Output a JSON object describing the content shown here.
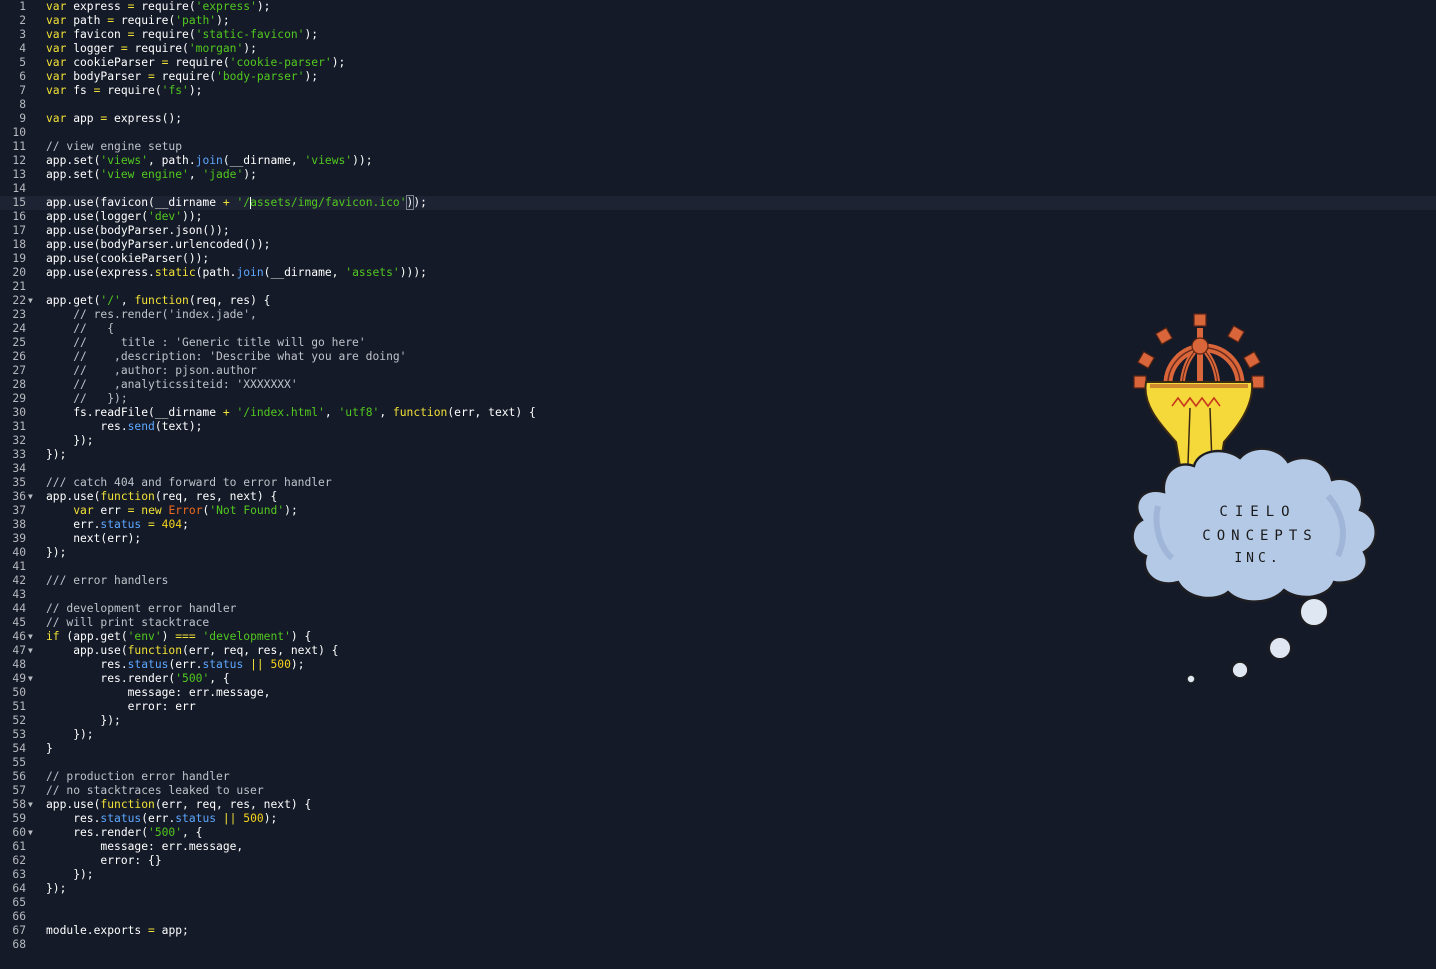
{
  "editor": {
    "lines": [
      {
        "t": [
          {
            "s": "var",
            "c": "k"
          },
          {
            "s": " express "
          },
          {
            "s": "=",
            "c": "k"
          },
          {
            "s": " require("
          },
          {
            "s": "'express'",
            "c": "s"
          },
          {
            "s": ");"
          }
        ]
      },
      {
        "t": [
          {
            "s": "var",
            "c": "k"
          },
          {
            "s": " path "
          },
          {
            "s": "=",
            "c": "k"
          },
          {
            "s": " require("
          },
          {
            "s": "'path'",
            "c": "s"
          },
          {
            "s": ");"
          }
        ]
      },
      {
        "t": [
          {
            "s": "var",
            "c": "k"
          },
          {
            "s": " favicon "
          },
          {
            "s": "=",
            "c": "k"
          },
          {
            "s": " require("
          },
          {
            "s": "'static-favicon'",
            "c": "s"
          },
          {
            "s": ");"
          }
        ]
      },
      {
        "t": [
          {
            "s": "var",
            "c": "k"
          },
          {
            "s": " logger "
          },
          {
            "s": "=",
            "c": "k"
          },
          {
            "s": " require("
          },
          {
            "s": "'morgan'",
            "c": "s"
          },
          {
            "s": ");"
          }
        ]
      },
      {
        "t": [
          {
            "s": "var",
            "c": "k"
          },
          {
            "s": " cookieParser "
          },
          {
            "s": "=",
            "c": "k"
          },
          {
            "s": " require("
          },
          {
            "s": "'cookie-parser'",
            "c": "s"
          },
          {
            "s": ");"
          }
        ]
      },
      {
        "t": [
          {
            "s": "var",
            "c": "k"
          },
          {
            "s": " bodyParser "
          },
          {
            "s": "=",
            "c": "k"
          },
          {
            "s": " require("
          },
          {
            "s": "'body-parser'",
            "c": "s"
          },
          {
            "s": ");"
          }
        ]
      },
      {
        "t": [
          {
            "s": "var",
            "c": "k"
          },
          {
            "s": " fs "
          },
          {
            "s": "=",
            "c": "k"
          },
          {
            "s": " require("
          },
          {
            "s": "'fs'",
            "c": "s"
          },
          {
            "s": ");"
          }
        ]
      },
      {
        "t": []
      },
      {
        "t": [
          {
            "s": "var",
            "c": "k"
          },
          {
            "s": " app "
          },
          {
            "s": "=",
            "c": "k"
          },
          {
            "s": " express();"
          }
        ]
      },
      {
        "t": []
      },
      {
        "t": [
          {
            "s": "// view engine setup",
            "c": "c"
          }
        ]
      },
      {
        "t": [
          {
            "s": "app.set("
          },
          {
            "s": "'views'",
            "c": "s"
          },
          {
            "s": ", path."
          },
          {
            "s": "join",
            "c": "b"
          },
          {
            "s": "(__dirname, "
          },
          {
            "s": "'views'",
            "c": "s"
          },
          {
            "s": "));"
          }
        ]
      },
      {
        "t": [
          {
            "s": "app.set("
          },
          {
            "s": "'view engine'",
            "c": "s"
          },
          {
            "s": ", "
          },
          {
            "s": "'jade'",
            "c": "s"
          },
          {
            "s": ");"
          }
        ]
      },
      {
        "t": []
      },
      {
        "cur": true,
        "t": [
          {
            "s": "app.use(favicon(__dirname "
          },
          {
            "s": "+",
            "c": "k"
          },
          {
            "s": " "
          },
          {
            "s": "'/",
            "c": "s"
          },
          {
            "caret": true
          },
          {
            "s": "assets/img/favicon.ico'",
            "c": "s"
          },
          {
            "s": ")",
            "br": true
          },
          {
            "s": ");"
          }
        ]
      },
      {
        "t": [
          {
            "s": "app.use(logger("
          },
          {
            "s": "'dev'",
            "c": "s"
          },
          {
            "s": "));"
          }
        ]
      },
      {
        "t": [
          {
            "s": "app.use(bodyParser.json());"
          }
        ]
      },
      {
        "t": [
          {
            "s": "app.use(bodyParser.urlencoded());"
          }
        ]
      },
      {
        "t": [
          {
            "s": "app.use(cookieParser());"
          }
        ]
      },
      {
        "t": [
          {
            "s": "app.use(express."
          },
          {
            "s": "static",
            "c": "k"
          },
          {
            "s": "(path."
          },
          {
            "s": "join",
            "c": "b"
          },
          {
            "s": "(__dirname, "
          },
          {
            "s": "'assets'",
            "c": "s"
          },
          {
            "s": ")));"
          }
        ]
      },
      {
        "t": []
      },
      {
        "fold": true,
        "t": [
          {
            "s": "app.get("
          },
          {
            "s": "'/'",
            "c": "s"
          },
          {
            "s": ", "
          },
          {
            "s": "function",
            "c": "k"
          },
          {
            "s": "(req, res) {"
          }
        ]
      },
      {
        "t": [
          {
            "s": "    // res.render('index.jade',",
            "c": "c"
          }
        ]
      },
      {
        "t": [
          {
            "s": "    //   {",
            "c": "c"
          }
        ]
      },
      {
        "t": [
          {
            "s": "    //     title : 'Generic title will go here'",
            "c": "c"
          }
        ]
      },
      {
        "t": [
          {
            "s": "    //    ,description: 'Describe what you are doing'",
            "c": "c"
          }
        ]
      },
      {
        "t": [
          {
            "s": "    //    ,author: pjson.author",
            "c": "c"
          }
        ]
      },
      {
        "t": [
          {
            "s": "    //    ,analyticssiteid: 'XXXXXXX'",
            "c": "c"
          }
        ]
      },
      {
        "t": [
          {
            "s": "    //   });",
            "c": "c"
          }
        ]
      },
      {
        "t": [
          {
            "s": "    fs.readFile(__dirname "
          },
          {
            "s": "+",
            "c": "k"
          },
          {
            "s": " "
          },
          {
            "s": "'/index.html'",
            "c": "s"
          },
          {
            "s": ", "
          },
          {
            "s": "'utf8'",
            "c": "s"
          },
          {
            "s": ", "
          },
          {
            "s": "function",
            "c": "k"
          },
          {
            "s": "(err, text) {"
          }
        ]
      },
      {
        "t": [
          {
            "s": "        res."
          },
          {
            "s": "send",
            "c": "b"
          },
          {
            "s": "(text);"
          }
        ]
      },
      {
        "t": [
          {
            "s": "    });"
          }
        ]
      },
      {
        "t": [
          {
            "s": "});"
          }
        ]
      },
      {
        "t": []
      },
      {
        "t": [
          {
            "s": "/// catch 404 and forward to error handler",
            "c": "c"
          }
        ]
      },
      {
        "fold": true,
        "t": [
          {
            "s": "app.use("
          },
          {
            "s": "function",
            "c": "k"
          },
          {
            "s": "(req, res, next) {"
          }
        ]
      },
      {
        "t": [
          {
            "s": "    "
          },
          {
            "s": "var",
            "c": "k"
          },
          {
            "s": " err "
          },
          {
            "s": "=",
            "c": "k"
          },
          {
            "s": " "
          },
          {
            "s": "new",
            "c": "k"
          },
          {
            "s": " "
          },
          {
            "s": "Error",
            "c": "cl"
          },
          {
            "s": "("
          },
          {
            "s": "'Not Found'",
            "c": "s"
          },
          {
            "s": ");"
          }
        ]
      },
      {
        "t": [
          {
            "s": "    err."
          },
          {
            "s": "status",
            "c": "b"
          },
          {
            "s": " "
          },
          {
            "s": "=",
            "c": "k"
          },
          {
            "s": " "
          },
          {
            "s": "404",
            "c": "n"
          },
          {
            "s": ";"
          }
        ]
      },
      {
        "t": [
          {
            "s": "    next(err);"
          }
        ]
      },
      {
        "t": [
          {
            "s": "});"
          }
        ]
      },
      {
        "t": []
      },
      {
        "t": [
          {
            "s": "/// error handlers",
            "c": "c"
          }
        ]
      },
      {
        "t": []
      },
      {
        "t": [
          {
            "s": "// development error handler",
            "c": "c"
          }
        ]
      },
      {
        "t": [
          {
            "s": "// will print stacktrace",
            "c": "c"
          }
        ]
      },
      {
        "fold": true,
        "t": [
          {
            "s": "if",
            "c": "k"
          },
          {
            "s": " (app.get("
          },
          {
            "s": "'env'",
            "c": "s"
          },
          {
            "s": ") "
          },
          {
            "s": "===",
            "c": "k"
          },
          {
            "s": " "
          },
          {
            "s": "'development'",
            "c": "s"
          },
          {
            "s": ") {"
          }
        ]
      },
      {
        "fold": true,
        "t": [
          {
            "s": "    app.use("
          },
          {
            "s": "function",
            "c": "k"
          },
          {
            "s": "(err, req, res, next) {"
          }
        ]
      },
      {
        "t": [
          {
            "s": "        res."
          },
          {
            "s": "status",
            "c": "b"
          },
          {
            "s": "(err."
          },
          {
            "s": "status",
            "c": "b"
          },
          {
            "s": " "
          },
          {
            "s": "||",
            "c": "k"
          },
          {
            "s": " "
          },
          {
            "s": "500",
            "c": "n"
          },
          {
            "s": ");"
          }
        ]
      },
      {
        "fold": true,
        "t": [
          {
            "s": "        res.render("
          },
          {
            "s": "'500'",
            "c": "s"
          },
          {
            "s": ", {"
          }
        ]
      },
      {
        "t": [
          {
            "s": "            message: err.message,"
          }
        ]
      },
      {
        "t": [
          {
            "s": "            error: err"
          }
        ]
      },
      {
        "t": [
          {
            "s": "        });"
          }
        ]
      },
      {
        "t": [
          {
            "s": "    });"
          }
        ]
      },
      {
        "t": [
          {
            "s": "}"
          }
        ]
      },
      {
        "t": []
      },
      {
        "t": [
          {
            "s": "// production error handler",
            "c": "c"
          }
        ]
      },
      {
        "t": [
          {
            "s": "// no stacktraces leaked to user",
            "c": "c"
          }
        ]
      },
      {
        "fold": true,
        "t": [
          {
            "s": "app.use("
          },
          {
            "s": "function",
            "c": "k"
          },
          {
            "s": "(err, req, res, next) {"
          }
        ]
      },
      {
        "t": [
          {
            "s": "    res."
          },
          {
            "s": "status",
            "c": "b"
          },
          {
            "s": "(err."
          },
          {
            "s": "status",
            "c": "b"
          },
          {
            "s": " "
          },
          {
            "s": "||",
            "c": "k"
          },
          {
            "s": " "
          },
          {
            "s": "500",
            "c": "n"
          },
          {
            "s": ");"
          }
        ]
      },
      {
        "fold": true,
        "t": [
          {
            "s": "    res.render("
          },
          {
            "s": "'500'",
            "c": "s"
          },
          {
            "s": ", {"
          }
        ]
      },
      {
        "t": [
          {
            "s": "        message: err.message,"
          }
        ]
      },
      {
        "t": [
          {
            "s": "        error: {}"
          }
        ]
      },
      {
        "t": [
          {
            "s": "    });"
          }
        ]
      },
      {
        "t": [
          {
            "s": "});"
          }
        ]
      },
      {
        "t": []
      },
      {
        "t": []
      },
      {
        "t": [
          {
            "s": "module.exports "
          },
          {
            "s": "=",
            "c": "k"
          },
          {
            "s": " app;"
          }
        ]
      },
      {
        "t": []
      }
    ]
  },
  "logo": {
    "line1": "CIELO",
    "line2": "CONCEPTS",
    "line3": "INC."
  },
  "colors": {
    "background": "#141a28",
    "keyword": "#f2e136",
    "string": "#52c81e",
    "comment": "#bfc2c9",
    "number": "#f6d31c",
    "class": "#f26a1e",
    "builtin": "#5da7ff"
  }
}
